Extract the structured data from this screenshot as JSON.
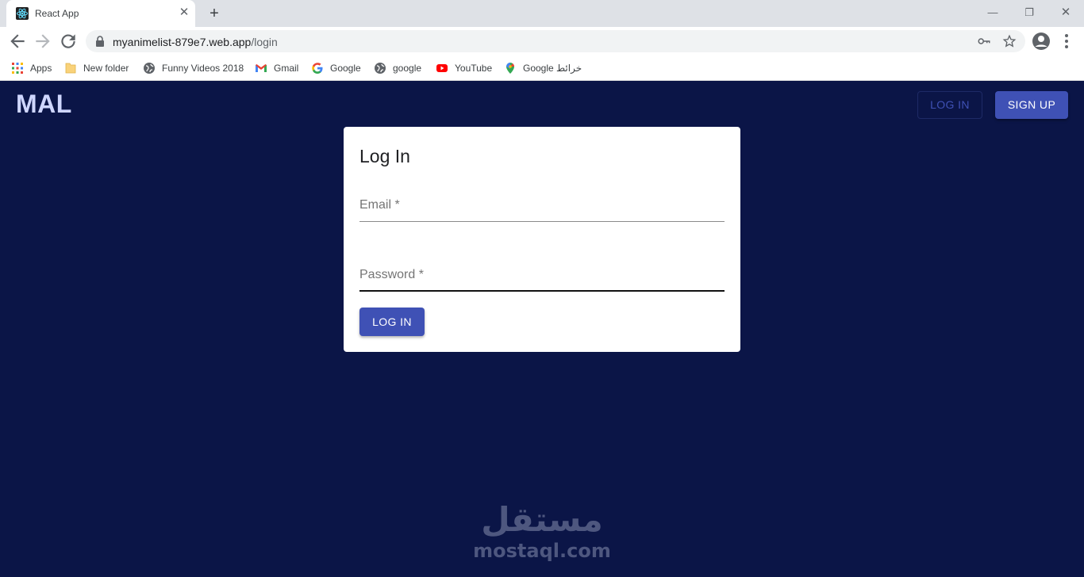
{
  "browser": {
    "tab_title": "React App",
    "url_host": "myanimelist-879e7.web.app",
    "url_path": "/login",
    "bookmarks": [
      {
        "label": "Apps",
        "icon": "apps-grid-icon"
      },
      {
        "label": "New folder",
        "icon": "folder-icon"
      },
      {
        "label": "Funny Videos 2018",
        "icon": "globe-icon"
      },
      {
        "label": "Gmail",
        "icon": "gmail-icon"
      },
      {
        "label": "Google",
        "icon": "google-icon"
      },
      {
        "label": "google",
        "icon": "globe-icon"
      },
      {
        "label": "YouTube",
        "icon": "youtube-icon"
      },
      {
        "label": "Google خرائط",
        "icon": "maps-pin-icon"
      }
    ]
  },
  "header": {
    "logo": "MAL",
    "login_label": "LOG IN",
    "signup_label": "SIGN UP"
  },
  "login_card": {
    "title": "Log In",
    "email_label": "Email *",
    "email_value": "",
    "password_label": "Password *",
    "password_value": "",
    "submit_label": "LOG IN"
  },
  "watermark": {
    "arabic": "مستقل",
    "latin": "mostaql.com"
  },
  "colors": {
    "page_background": "#0b1547",
    "primary": "#3f51b5",
    "logo": "#cfd6ff",
    "card": "#ffffff"
  }
}
